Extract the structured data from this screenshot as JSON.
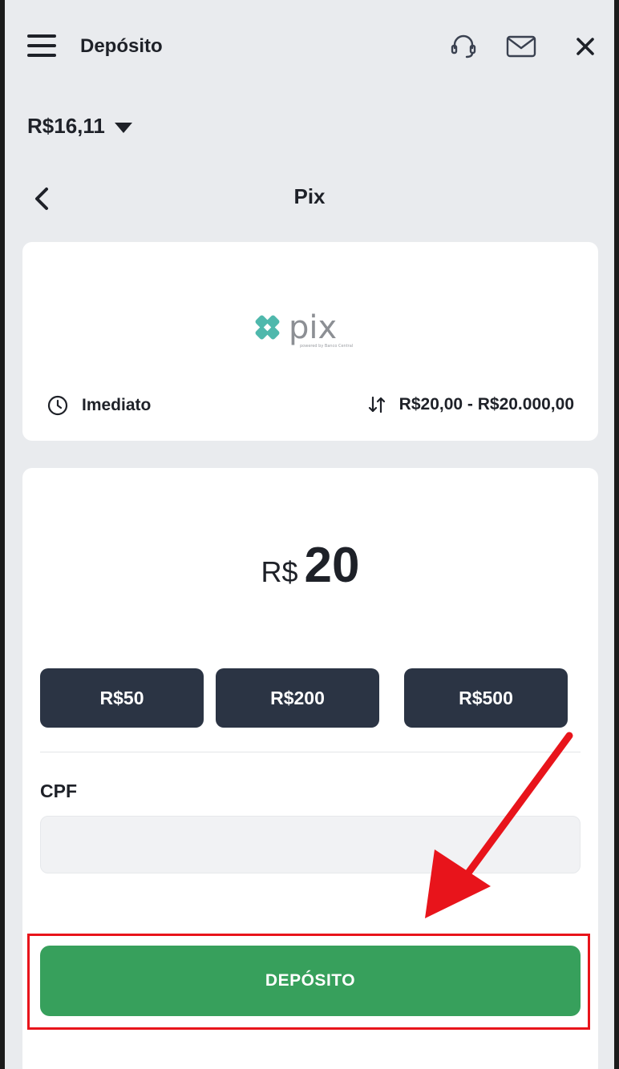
{
  "header": {
    "title": "Depósito",
    "menu_icon": "hamburger-icon",
    "support_icon": "headset-icon",
    "mail_icon": "envelope-icon",
    "close_icon": "close-icon"
  },
  "balance": {
    "amount": "R$16,11",
    "icon": "caret-down-icon"
  },
  "method": {
    "title": "Pix",
    "back_icon": "chevron-left-icon",
    "logo_text": "pix",
    "logo_subtext": "powered by Banco Central",
    "processing_time": "Imediato",
    "limits": "R$20,00 - R$20.000,00"
  },
  "deposit_form": {
    "currency": "R$",
    "amount": "20",
    "quick_amounts": [
      "R$50",
      "R$200",
      "R$500"
    ],
    "cpf_label": "CPF",
    "cpf_value": "",
    "submit_label": "DEPÓSITO"
  },
  "annotation": {
    "color": "#e8141b"
  },
  "colors": {
    "background": "#e9ebee",
    "card": "#ffffff",
    "quick_button": "#2b3444",
    "primary_button": "#37a05c",
    "pix_teal": "#4fb8ac"
  }
}
